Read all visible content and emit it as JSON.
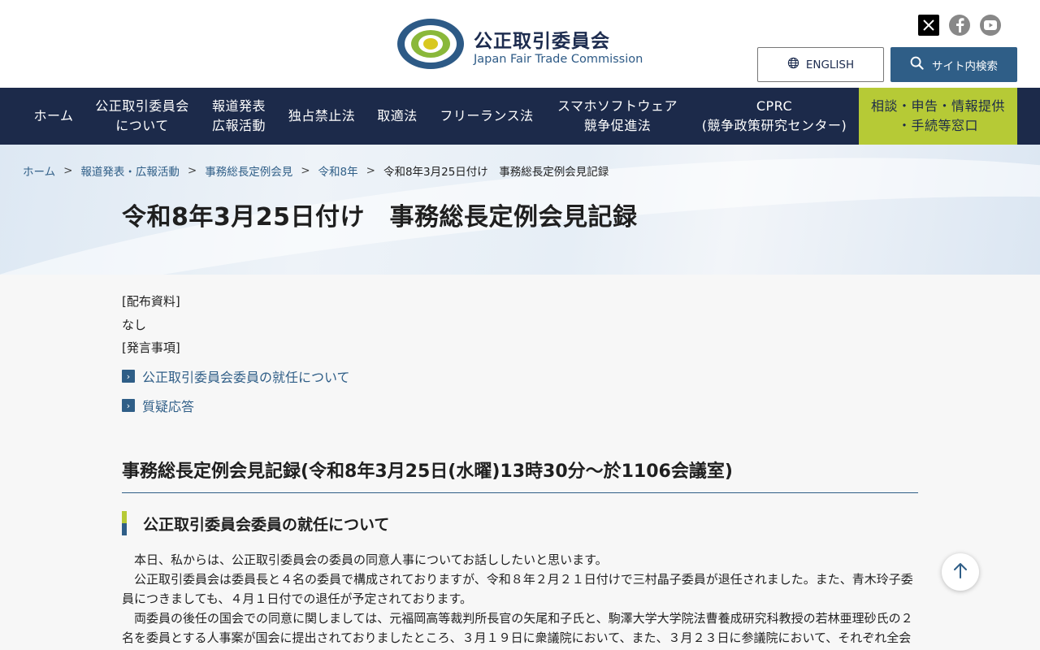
{
  "header": {
    "org_name_ja": "公正取引委員会",
    "org_name_en": "Japan Fair Trade Commission",
    "english_button": "ENGLISH",
    "search_button": "サイト内検索",
    "social": [
      "x-icon",
      "facebook-icon",
      "youtube-icon"
    ]
  },
  "nav": {
    "items": [
      {
        "label": "ホーム"
      },
      {
        "line1": "公正取引委員会",
        "line2": "について"
      },
      {
        "line1": "報道発表",
        "line2": "広報活動"
      },
      {
        "label": "独占禁止法"
      },
      {
        "label": "取適法"
      },
      {
        "label": "フリーランス法"
      },
      {
        "line1": "スマホソフトウェア",
        "line2": "競争促進法"
      },
      {
        "line1": "CPRC",
        "line2": "(競争政策研究センター)"
      },
      {
        "line1": "相談・申告・情報提供",
        "line2": "・手続等窓口"
      }
    ]
  },
  "breadcrumb": {
    "items": [
      "ホーム",
      "報道発表・広報活動",
      "事務総長定例会見",
      "令和8年"
    ],
    "current": "令和8年3月25日付け　事務総長定例会見記録"
  },
  "page_title": "令和8年3月25日付け　事務総長定例会見記録",
  "content": {
    "handout_label": "[配布資料]",
    "handout_value": "なし",
    "remarks_label": "[発言事項]",
    "toc": [
      "公正取引委員会委員の就任について",
      "質疑応答"
    ],
    "section_title": "事務総長定例会見記録(令和8年3月25日(水曜)13時30分～於1106会議室)",
    "subsection_title": "公正取引委員会委員の就任について",
    "paragraphs": [
      "本日、私からは、公正取引委員会の委員の同意人事についてお話ししたいと思います。",
      "公正取引委員会は委員長と４名の委員で構成されておりますが、令和８年２月２１日付けで三村晶子委員が退任されました。また、青木玲子委員につきましても、４月１日付での退任が予定されております。",
      "両委員の後任の国会での同意に関しましては、元福岡高等裁判所長官の矢尾和子氏と、駒澤大学大学院法曹養成研究科教授の若林亜理砂氏の２名を委員とする人事案が国会に提出されておりましたところ、３月１９日に衆議院において、また、３月２３日に参議院において、それぞれ全会"
    ]
  },
  "colors": {
    "navy": "#1c2a4a",
    "link_blue": "#2f5e87",
    "accent_green": "#b6ca36"
  }
}
